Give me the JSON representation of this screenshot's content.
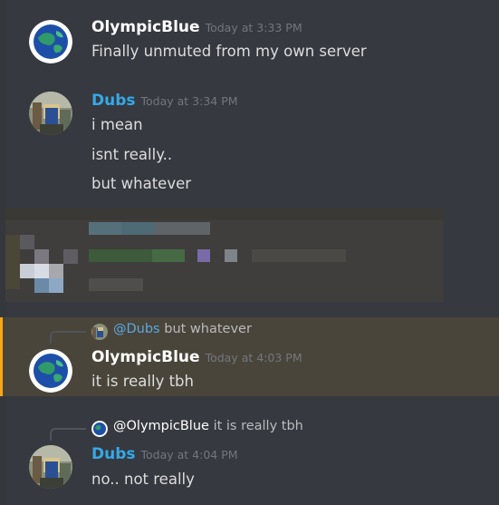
{
  "messages": [
    {
      "username": "OlympicBlue",
      "timestamp": "Today at 3:33 PM",
      "lines": [
        "Finally unmuted from my own server"
      ]
    },
    {
      "username": "Dubs",
      "timestamp": "Today at 3:34 PM",
      "lines": [
        "i mean",
        "isnt really..",
        "but whatever"
      ]
    },
    {
      "reply": {
        "mention": "@Dubs",
        "text": "but whatever"
      },
      "username": "OlympicBlue",
      "timestamp": "Today at 4:03 PM",
      "lines": [
        "it is really tbh"
      ],
      "highlighted": true
    },
    {
      "reply": {
        "mention": "@OlympicBlue",
        "text": "it is really tbh"
      },
      "username": "Dubs",
      "timestamp": "Today at 4:04 PM",
      "lines": [
        "no.. not really"
      ]
    }
  ],
  "colors": {
    "background": "#36393f",
    "username_default": "#ffffff",
    "username_dubs": "#35a9e8",
    "highlight_bar": "#faa61a",
    "highlight_bg": "#4a453a",
    "text": "#dcddde",
    "timestamp": "#72767d"
  },
  "icons": [
    "globe-avatar-icon",
    "roblox-avatar-icon"
  ]
}
